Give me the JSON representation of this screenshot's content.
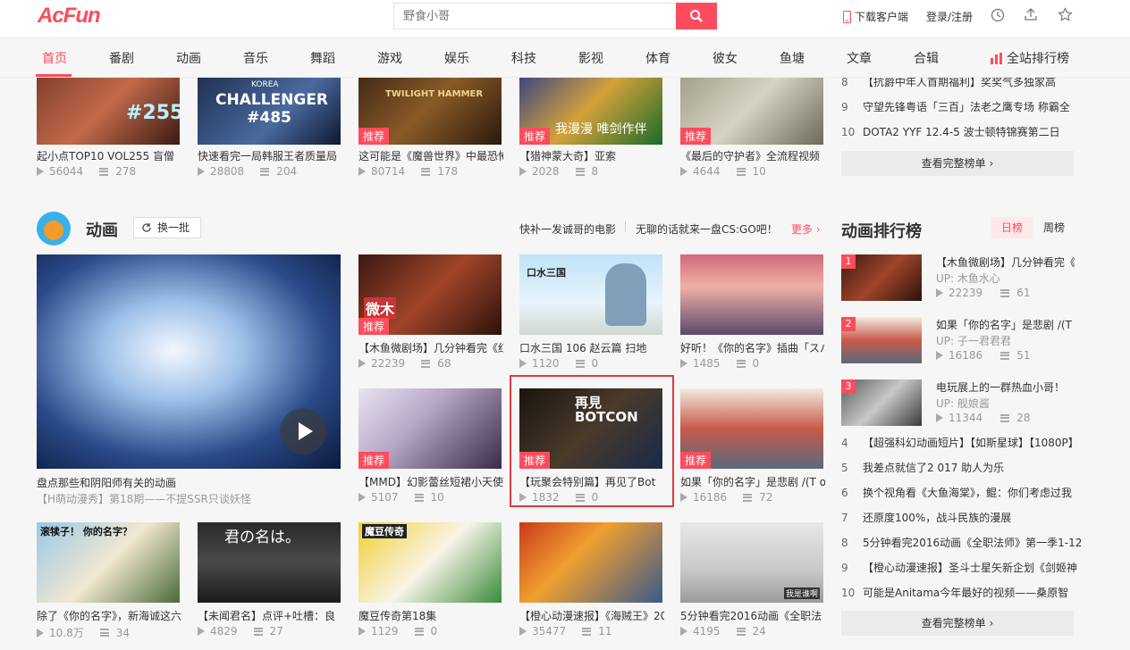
{
  "header": {
    "logo": "AcFun",
    "search_placeholder": "野食小哥",
    "download": "下载客户端",
    "login": "登录/注册"
  },
  "nav": {
    "items": [
      "首页",
      "番剧",
      "动画",
      "音乐",
      "舞蹈",
      "游戏",
      "娱乐",
      "科技",
      "影视",
      "体育",
      "彼女",
      "鱼塘",
      "文章",
      "合辑"
    ],
    "ranking": "全站排行榜"
  },
  "top_row": [
    {
      "title": "起小点TOP10 VOL255 盲僧",
      "views": "56044",
      "comments": "278",
      "tag": "",
      "overlay": "#255"
    },
    {
      "title": "快速看完一局韩服王者质量局",
      "views": "28808",
      "comments": "204",
      "tag": "",
      "overlay": "CHALLENGER #485",
      "small": "KOREA"
    },
    {
      "title": "这可能是《魔兽世界》中最恐怖",
      "views": "80714",
      "comments": "178",
      "tag": "推荐",
      "overlay": "TWILIGHT HAMMER"
    },
    {
      "title": "【猎神蒙大奇】亚索",
      "views": "2028",
      "comments": "8",
      "tag": "推荐",
      "overlay": "我漫漫 唯剑作伴"
    },
    {
      "title": "《最后的守护者》全流程视频",
      "views": "4644",
      "comments": "10",
      "tag": "推荐",
      "overlay": ""
    }
  ],
  "top_ranking": {
    "items": [
      {
        "num": "8",
        "text": "【抗爵中年人首期福利】奖奖气多独家高"
      },
      {
        "num": "9",
        "text": "守望先锋粤语「三百」法老之鹰专场  称霸全"
      },
      {
        "num": "10",
        "text": "DOTA2 YYF  12.4-5  波士顿特锦赛第二日"
      }
    ],
    "more": "查看完整榜单"
  },
  "section": {
    "title": "动画",
    "refresh": "换一批",
    "links": [
      "快补一发诚哥的电影",
      "无聊的话就来一盘CS:GO吧！"
    ],
    "more": "更多",
    "featured_title": "盘点那些和阴阳师有关的动画",
    "featured_sub": "【H萌动漫秀】第18期——不提SSR只谈妖怪"
  },
  "grid": [
    {
      "title": "【木鱼微剧场】几分钟看完《红",
      "views": "22239",
      "comments": "68",
      "tag": "推荐",
      "overlay": "微木"
    },
    {
      "title": "口水三国  106  赵云篇  扫地",
      "views": "1120",
      "comments": "0",
      "tag": "",
      "overlay": "口水三国"
    },
    {
      "title": "好听！《你的名字》插曲「スパ",
      "views": "1485",
      "comments": "0",
      "tag": "",
      "overlay": ""
    },
    {
      "title": "【MMD】幻影蕾丝短裙小天使",
      "views": "5107",
      "comments": "10",
      "tag": "推荐",
      "overlay": ""
    },
    {
      "title": "【玩聚会特别篇】再见了Bot",
      "views": "1832",
      "comments": "0",
      "tag": "推荐",
      "overlay": "再見 BOTCON"
    },
    {
      "title": "如果「你的名字」是悲剧  /(T o",
      "views": "16186",
      "comments": "72",
      "tag": "推荐",
      "overlay": ""
    }
  ],
  "bottom_row": [
    {
      "title": "除了《你的名字》，新海诚这六",
      "views": "10.8万",
      "comments": "34",
      "overlay": "滚犊子！ 你的名字？"
    },
    {
      "title": "【未闻君名】点评+吐槽：良",
      "views": "4829",
      "comments": "27",
      "overlay": "君の名は。"
    },
    {
      "title": "魔豆传奇第18集",
      "views": "1129",
      "comments": "0",
      "overlay": "魔豆传奇"
    },
    {
      "title": "【橙心动漫速报】《海贼王》20",
      "views": "35477",
      "comments": "11",
      "overlay": ""
    },
    {
      "title": "5分钟看完2016动画《全职法",
      "views": "4195",
      "comments": "24",
      "overlay": "我是谁啊"
    }
  ],
  "anime_ranking": {
    "title": "动画排行榜",
    "tab_daily": "日榜",
    "tab_weekly": "周榜",
    "top3": [
      {
        "rank": "1",
        "title": "【木鱼微剧场】几分钟看完《红",
        "up": "UP: 木鱼水心",
        "views": "22239",
        "comments": "61"
      },
      {
        "rank": "2",
        "title": "如果「你的名字」是悲剧  /(T",
        "up": "UP: 子一君君君",
        "views": "16186",
        "comments": "51"
      },
      {
        "rank": "3",
        "title": "电玩展上的一群热血小哥！",
        "up": "UP: 舰娘酱",
        "views": "11344",
        "comments": "28"
      }
    ],
    "items": [
      {
        "num": "4",
        "text": "【超强科幻动画短片】【如斯星球】【1080P】"
      },
      {
        "num": "5",
        "text": "我差点就信了2  017  助人为乐"
      },
      {
        "num": "6",
        "text": "换个视角看《大鱼海棠》，鲲：你们考虑过我"
      },
      {
        "num": "7",
        "text": "还原度100%，战斗民族的漫展"
      },
      {
        "num": "8",
        "text": "5分钟看完2016动画《全职法师》第一季1-12"
      },
      {
        "num": "9",
        "text": "【橙心动漫速报】圣斗士星矢新企划《剑姬神"
      },
      {
        "num": "10",
        "text": "可能是Anitama今年最好的视频——桑原智"
      }
    ],
    "more": "查看完整榜单"
  }
}
